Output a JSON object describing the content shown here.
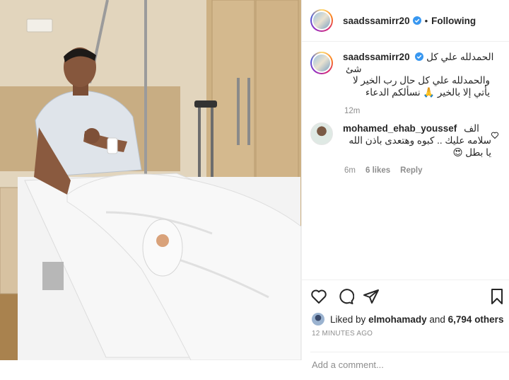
{
  "header": {
    "username": "saadssamirr20",
    "separator": "•",
    "follow_status": "Following"
  },
  "caption": {
    "username": "saadssamirr20",
    "line1": "الحمدلله علي كل شئ",
    "line2": "والحمدلله علي كل حال رب الخير لا يأتي إلا بالخير 🙏 نسألكم الدعاء",
    "time": "12m"
  },
  "comment": {
    "username": "mohamed_ehab_youssef",
    "prefix": "الف",
    "text": "سلامه عليك .. كبوه وهتعدى باذن الله",
    "text2": "يا بطل 😍",
    "time": "6m",
    "likes": "6 likes",
    "reply": "Reply"
  },
  "likes": {
    "prefix": "Liked by",
    "user": "elmohamady",
    "middle": "and",
    "count": "6,794 others"
  },
  "timestamp": "12 MINUTES AGO",
  "add_comment": {
    "placeholder": "Add a comment..."
  },
  "colors": {
    "verified": "#3897f0",
    "text": "#262626",
    "muted": "#8e8e8e"
  },
  "icons": [
    "heart-icon",
    "comment-icon",
    "share-icon",
    "bookmark-icon",
    "verified-icon"
  ]
}
